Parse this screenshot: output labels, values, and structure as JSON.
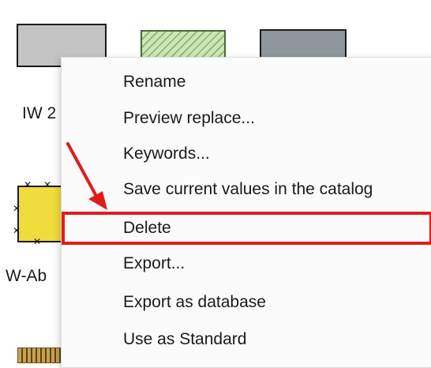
{
  "thumbnails": {
    "labels": [
      "IW 2",
      "W-Ab"
    ]
  },
  "menu": {
    "items": [
      "Rename",
      "Preview replace...",
      "Keywords...",
      "Save current values in the catalog",
      "Delete",
      "Export...",
      "Export as database",
      "Use as Standard"
    ]
  },
  "annotation": {
    "highlight_color": "#e21b1b",
    "highlighted_item": "Delete"
  }
}
